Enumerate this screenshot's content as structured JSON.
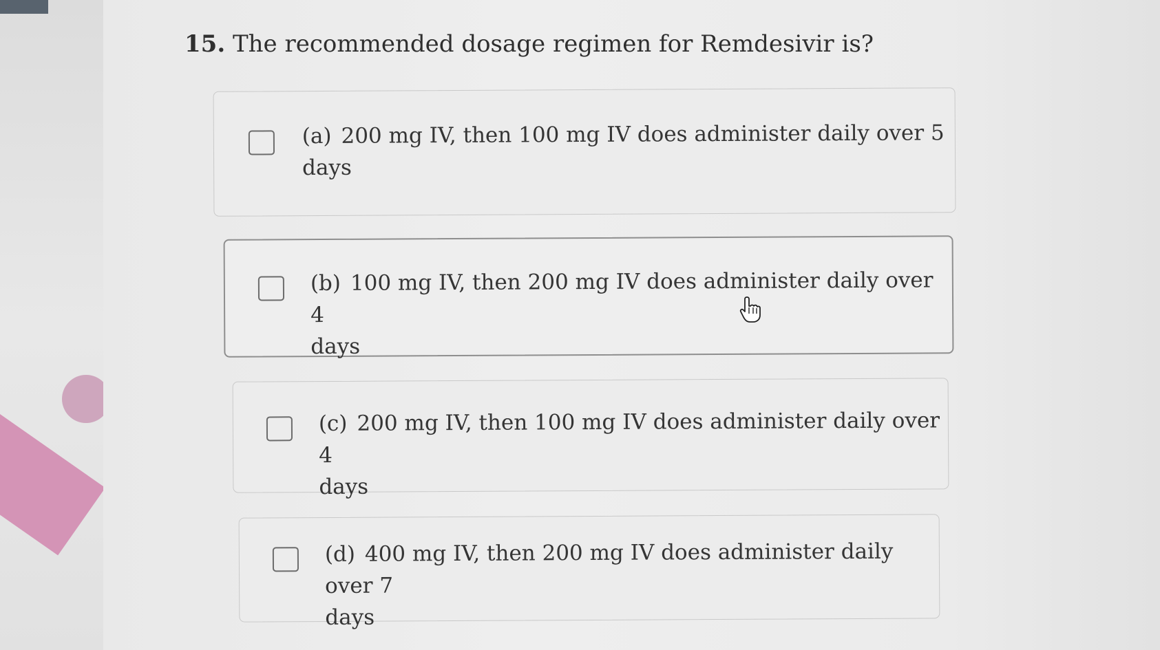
{
  "question": {
    "number": "15.",
    "text": "The recommended dosage regimen for Remdesivir is?"
  },
  "options": [
    {
      "letter": "(a)",
      "line1": "200 mg IV, then 100 mg IV does administer daily over 5",
      "line2": "days"
    },
    {
      "letter": "(b)",
      "line1": "100 mg IV, then 200 mg IV does administer daily over 4",
      "line2": "days"
    },
    {
      "letter": "(c)",
      "line1": "200 mg IV, then 100 mg IV does administer daily over 4",
      "line2": "days"
    },
    {
      "letter": "(d)",
      "line1": "400 mg IV, then 200 mg IV does administer daily over 7",
      "line2": "days"
    }
  ],
  "cursor": {
    "icon": "hand-pointer-icon"
  }
}
